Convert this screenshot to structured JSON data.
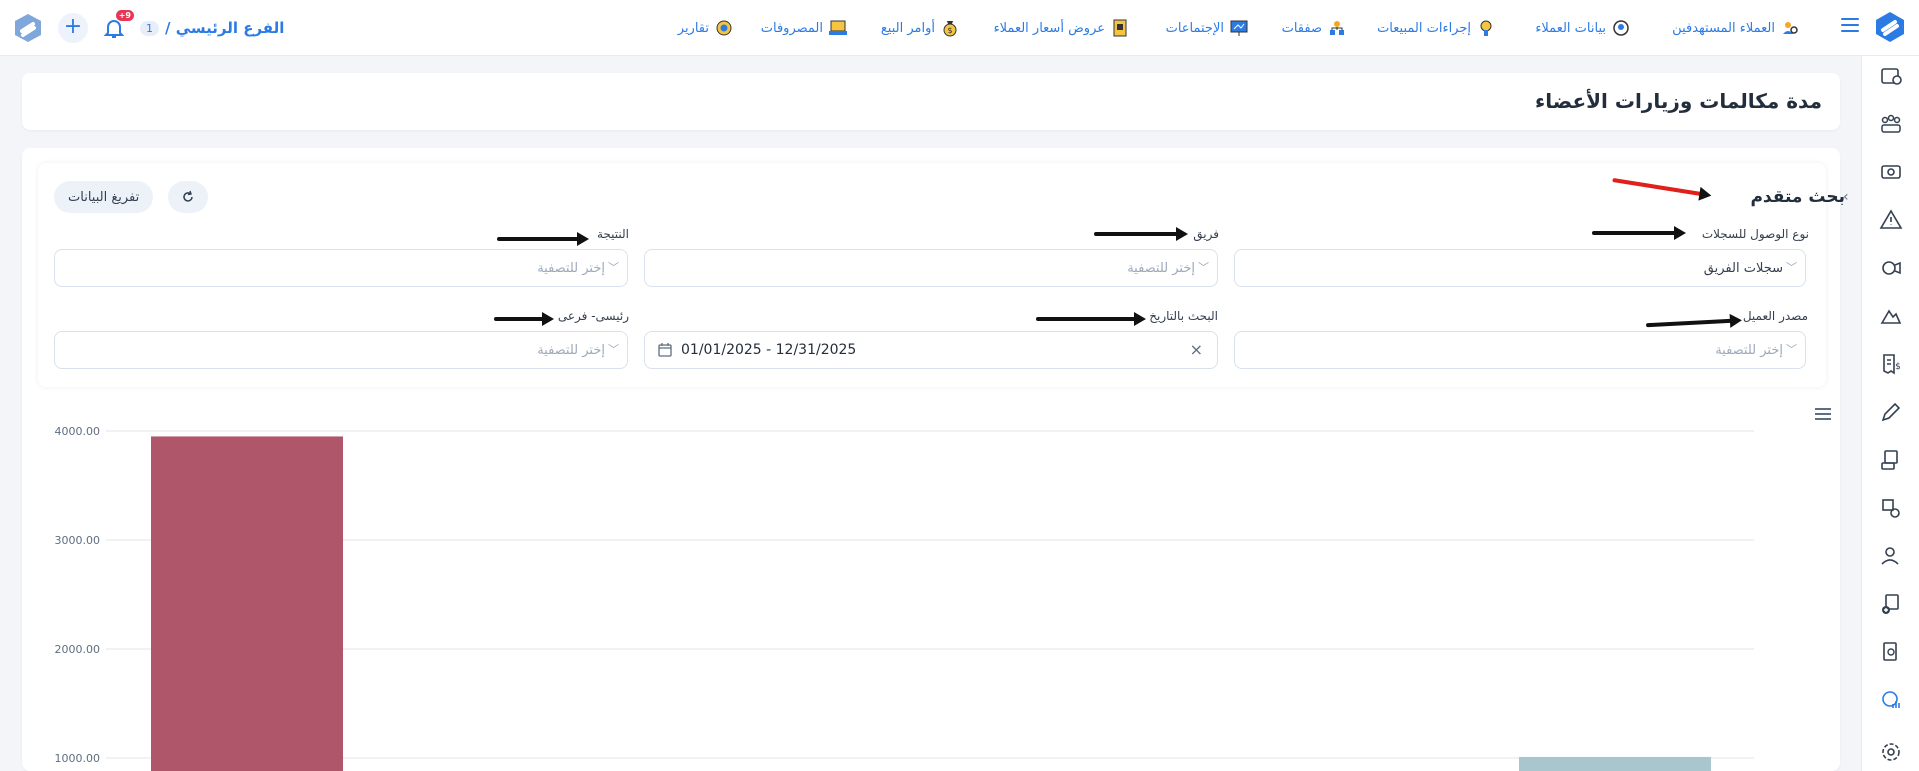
{
  "nav": {
    "branch_label": "الفرع الرئيسي /",
    "branch_number": "1",
    "notification_badge": "+9",
    "menu_items": [
      {
        "label": "العملاء المستهدفين",
        "icon": "target-customers-icon"
      },
      {
        "label": "بيانات العملاء",
        "icon": "customer-data-icon"
      },
      {
        "label": "إجراءات المبيعات",
        "icon": "sales-procedures-icon"
      },
      {
        "label": "صفقات",
        "icon": "deals-icon"
      },
      {
        "label": "الإجتماعات",
        "icon": "meetings-icon"
      },
      {
        "label": "عروض أسعار العملاء",
        "icon": "quotes-icon"
      },
      {
        "label": "أوامر البيع",
        "icon": "sales-orders-icon"
      },
      {
        "label": "المصروفات",
        "icon": "expenses-icon"
      },
      {
        "label": "تقارير",
        "icon": "reports-icon"
      }
    ]
  },
  "page": {
    "title": "مدة مكالمات وزيارات الأعضاء"
  },
  "filters": {
    "section_title": "بحث متقدم",
    "clear_label": "تفريغ البيانات",
    "fields": {
      "access_type": {
        "label": "نوع الوصول للسجلات",
        "value": "سجلات الفريق"
      },
      "team": {
        "label": "فريق",
        "placeholder": "إختر للتصفية"
      },
      "result": {
        "label": "النتيجة",
        "placeholder": "إختر للتصفية"
      },
      "customer_source": {
        "label": "مصدر العميل",
        "placeholder": "إختر للتصفية"
      },
      "date_search": {
        "label": "البحث بالتاريخ",
        "value": "01/01/2025 - 12/31/2025"
      },
      "main_sub": {
        "label": "رئيسى- فرعى",
        "placeholder": "إختر للتصفية"
      }
    }
  },
  "chart_data": {
    "type": "bar",
    "y_ticks": [
      "4000.00",
      "3000.00",
      "2000.00",
      "1000.00"
    ],
    "ylim_visible": [
      850,
      4000
    ],
    "bars": [
      {
        "value": 3950,
        "color": "#b0566a"
      },
      {
        "value": 1010,
        "color": "#a9c6cf"
      }
    ]
  }
}
